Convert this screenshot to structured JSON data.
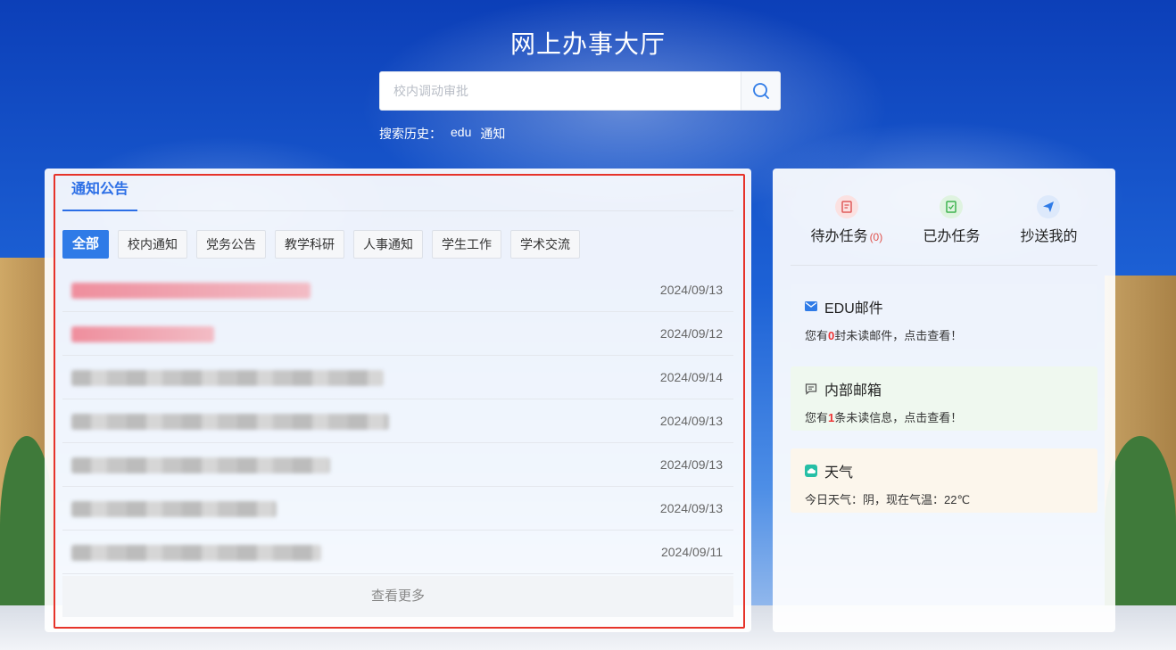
{
  "page": {
    "title": "网上办事大厅"
  },
  "search": {
    "placeholder": "校内调动审批",
    "history_label": "搜索历史：",
    "history": [
      "edu",
      "通知"
    ]
  },
  "notice": {
    "tab": "通知公告",
    "categories": [
      "全部",
      "校内通知",
      "党务公告",
      "教学科研",
      "人事通知",
      "学生工作",
      "学术交流"
    ],
    "active_category": "全部",
    "items": [
      {
        "date": "2024/09/13"
      },
      {
        "date": "2024/09/12"
      },
      {
        "date": "2024/09/14"
      },
      {
        "date": "2024/09/13"
      },
      {
        "date": "2024/09/13"
      },
      {
        "date": "2024/09/13"
      },
      {
        "date": "2024/09/11"
      }
    ],
    "more": "查看更多"
  },
  "tasks": [
    {
      "label": "待办任务",
      "count": "(0)",
      "icon": "todo-doc-icon",
      "color": "#e05a5a"
    },
    {
      "label": "已办任务",
      "count": "",
      "icon": "done-doc-icon",
      "color": "#3fb34f"
    },
    {
      "label": "抄送我的",
      "count": "",
      "icon": "send-icon",
      "color": "#2f7be7"
    }
  ],
  "cards": {
    "mail": {
      "title": "EDU邮件",
      "prefix": "您有",
      "count": "0",
      "suffix": "封未读邮件，点击查看！",
      "icon": "envelope-icon"
    },
    "inbox": {
      "title": "内部邮箱",
      "prefix": "您有",
      "count": "1",
      "suffix": "条未读信息，点击查看！",
      "icon": "message-icon"
    },
    "weather": {
      "title": "天气",
      "text": "今日天气：阴，现在气温：22℃",
      "icon": "cloud-icon"
    }
  },
  "colors": {
    "accent": "#2f7be7",
    "highlight": "#e6332a"
  }
}
